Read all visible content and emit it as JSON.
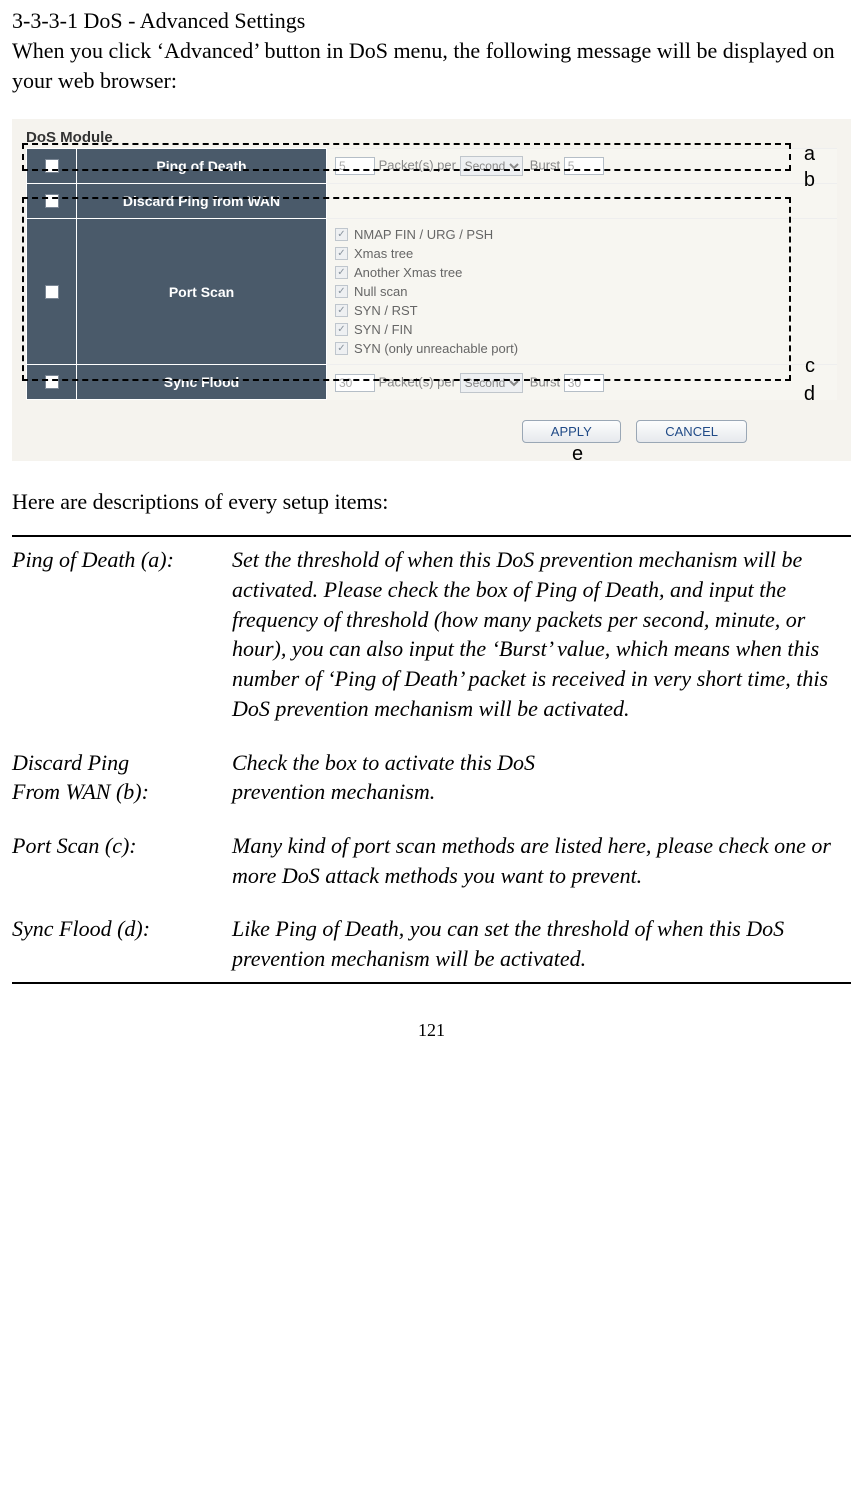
{
  "heading": "3-3-3-1 DoS - Advanced Settings",
  "intro": "When you click ‘Advanced’ button in DoS menu, the following message will be displayed on your web browser:",
  "module": {
    "title": "DoS Module",
    "rows": {
      "ping_of_death": {
        "label": "Ping of Death",
        "packets_value": "5",
        "packets_per": "Packet(s) per",
        "unit": "Second",
        "burst_label": "Burst",
        "burst_value": "5"
      },
      "discard_ping": {
        "label": "Discard Ping from WAN"
      },
      "port_scan": {
        "label": "Port Scan",
        "items": [
          "NMAP FIN / URG / PSH",
          "Xmas tree",
          "Another Xmas tree",
          "Null scan",
          "SYN / RST",
          "SYN / FIN",
          "SYN (only unreachable port)"
        ]
      },
      "sync_flood": {
        "label": "Sync Flood",
        "packets_value": "30",
        "packets_per": "Packet(s) per",
        "unit": "Second",
        "burst_label": "Burst",
        "burst_value": "30"
      }
    },
    "buttons": {
      "apply": "APPLY",
      "cancel": "CANCEL"
    },
    "letters": {
      "a": "a",
      "b": "b",
      "c": "c",
      "d": "d",
      "e": "e"
    }
  },
  "descriptions": {
    "intro": "Here are descriptions of every setup items:",
    "items": [
      {
        "key": "Ping of Death (a):",
        "val": "Set the threshold of when this DoS prevention mechanism will be activated. Please check the box of Ping of Death, and input the frequency of threshold (how many packets per second, minute, or hour), you can also input the ‘Burst’ value, which means when this number of ‘Ping of Death’ packet is received in very short time, this DoS prevention mechanism will be activated."
      },
      {
        "key": "Discard Ping\nFrom WAN (b):",
        "val": "Check the box to activate this DoS\nprevention mechanism."
      },
      {
        "key": "Port Scan (c):",
        "val": "Many kind of port scan methods are listed here, please check one or more DoS attack methods you want to prevent."
      },
      {
        "key": "Sync Flood (d):",
        "val": "Like Ping of Death, you can set the threshold of when this DoS prevention mechanism will be activated."
      }
    ]
  },
  "page_number": "121"
}
